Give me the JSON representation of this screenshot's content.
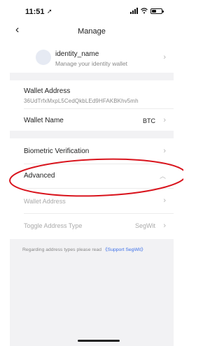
{
  "status_bar": {
    "time": "11:51"
  },
  "nav": {
    "title": "Manage",
    "back_glyph": "‹"
  },
  "identity": {
    "name": "identity_name",
    "subtitle": "Manage your identity wallet"
  },
  "wallet_address": {
    "label": "Wallet Address",
    "value": "36UdTrfxMxpL5CedQkbLEd9HFAKBKhv5mh"
  },
  "wallet_name": {
    "label": "Wallet Name",
    "value": "BTC"
  },
  "biometric": {
    "label": "Biometric Verification"
  },
  "advanced": {
    "label": "Advanced"
  },
  "advanced_wallet_address": {
    "label": "Wallet Address"
  },
  "toggle_address_type": {
    "label": "Toggle Address Type",
    "value": "SegWit"
  },
  "notice": {
    "text": "Regarding address types please read ",
    "link": "《Support SegWit》"
  },
  "icons": {
    "location": "location-arrow-icon",
    "back": "chevron-left-icon",
    "chevron": "chevron-right-icon",
    "collapse": "chevron-up-icon"
  },
  "colors": {
    "link": "#3a6ee8",
    "annotation": "#d9141d",
    "background": "#f2f2f4"
  }
}
